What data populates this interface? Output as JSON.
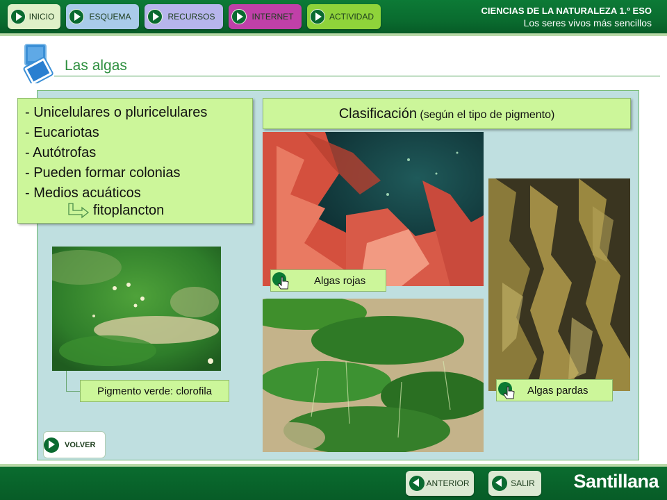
{
  "header": {
    "nav": [
      {
        "label": "INICIO",
        "color": "#dff0c8"
      },
      {
        "label": "ESQUEMA",
        "color": "#a9cbea"
      },
      {
        "label": "RECURSOS",
        "color": "#b7b5ec"
      },
      {
        "label": "INTERNET",
        "color": "#c040a8"
      },
      {
        "label": "ACTIVIDAD",
        "color": "#8fd33a"
      }
    ],
    "course": "CIENCIAS DE LA NATURALEZA 1.º ESO",
    "unit": "Los seres vivos más sencillos"
  },
  "section": {
    "title": "Las algas"
  },
  "features": [
    "- Unicelulares o pluricelulares",
    "- Eucariotas",
    "- Autótrofas",
    "- Pueden formar colonias",
    "- Medios acuáticos"
  ],
  "fitoplancton": "fitoplancton",
  "classification": {
    "title": "Clasificación",
    "subtitle": "(según el tipo de pigmento)"
  },
  "labels": {
    "verde": "Pigmento verde: clorofila",
    "rojas": "Algas rojas",
    "pardas": "Algas pardas"
  },
  "volver": "VOLVER",
  "footer": {
    "anterior": "ANTERIOR",
    "salir": "SALIR",
    "brand": "Santillana"
  },
  "colors": {
    "accent": "#0a6c2f",
    "box": "#ccf69a",
    "panel": "#bfdfe0"
  }
}
